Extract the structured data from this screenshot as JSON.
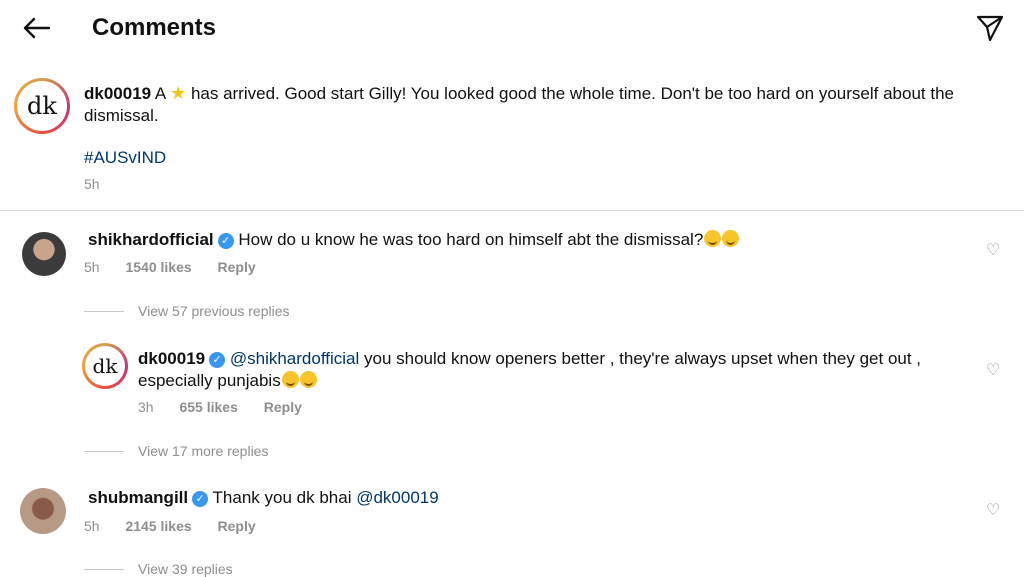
{
  "header": {
    "title": "Comments",
    "back_icon": "arrow-left-icon",
    "share_icon": "send-icon"
  },
  "caption": {
    "username": "dk00019",
    "text_before_star": "A",
    "text_after_star": "has arrived. Good start Gilly! You looked good the whole time. Don't be too hard on yourself about the dismissal.",
    "hashtag": "#AUSvIND",
    "time": "5h",
    "avatar_text": "dk"
  },
  "comments": [
    {
      "username": "shikhardofficial",
      "text": "How do u know he was too hard on himself abt the dismissal?",
      "time": "5h",
      "likes": "1540 likes",
      "reply": "Reply",
      "view_replies": "View 57 previous replies"
    },
    {
      "username": "dk00019",
      "mention": "@shikhardofficial",
      "text": "you should know openers better , they're always upset when they get out , especially punjabis",
      "time": "3h",
      "likes": "655 likes",
      "reply": "Reply",
      "avatar_text": "dk",
      "view_replies": "View 17 more replies"
    },
    {
      "username": "shubmangill",
      "text": "Thank you dk bhai",
      "mention": "@dk00019",
      "time": "5h",
      "likes": "2145 likes",
      "reply": "Reply",
      "view_replies": "View 39 replies"
    }
  ],
  "colors": {
    "link": "#00376b",
    "verified": "#3897f0",
    "meta": "#8e8e8e"
  }
}
